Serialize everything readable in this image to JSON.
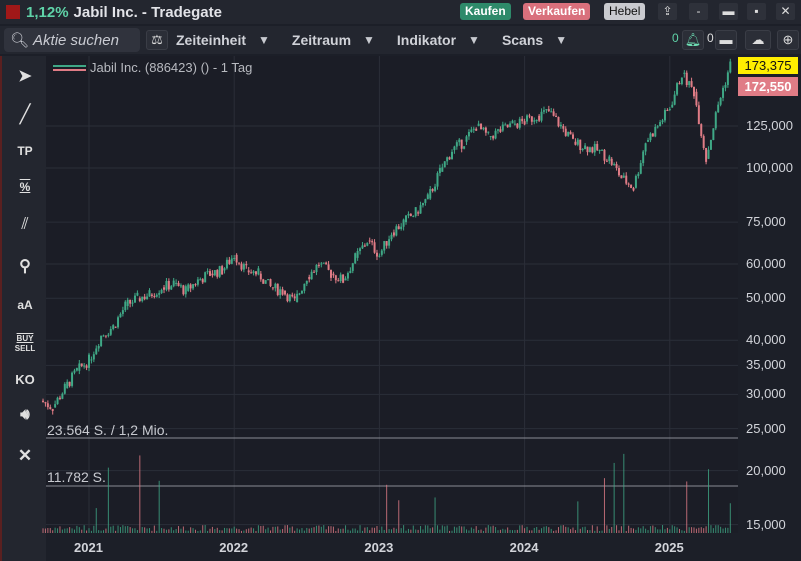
{
  "titlebar": {
    "change": "1,12%",
    "title": "Jabil Inc. - Tradegate",
    "buy": "Kaufen",
    "sell": "Verkaufen",
    "leverage": "Hebel",
    "minimize": "-",
    "restore": "▬",
    "close": "✕"
  },
  "toolbar": {
    "search_placeholder": "Aktie suchen",
    "menus": [
      "Zeiteinheit",
      "Zeitraum",
      "Indikator",
      "Scans"
    ],
    "alert_count": "0",
    "folder_count": "0"
  },
  "sidebar": {
    "tools": [
      "cursor-crosshair",
      "line",
      "TP",
      "%",
      "parallel-lines",
      "zoom",
      "aA",
      "BUY SELL",
      "KO",
      "sound",
      "close"
    ],
    "tp": "TP",
    "pct": "%",
    "text": "aA",
    "buy": "BUY",
    "sell": "SELL",
    "ko": "KO"
  },
  "legend": {
    "label": "Jabil Inc. (886423) () - 1 Tag"
  },
  "colors": {
    "up": "#3fa886",
    "down": "#e07c86",
    "last": "#ffee00",
    "bid": "#e07c86",
    "buy": "#2e8a6a",
    "sell": "#d9707c"
  },
  "chart_data": {
    "type": "candlestick",
    "scale": "log",
    "ylim": [
      14000,
      180000
    ],
    "yticks": [
      "125,000",
      "100,000",
      "75,000",
      "60,000",
      "50,000",
      "40,000",
      "35,000",
      "30,000",
      "25,000",
      "20,000",
      "15,000"
    ],
    "ytick_values": [
      125,
      100,
      75,
      60,
      50,
      40,
      35,
      30,
      25,
      20,
      15
    ],
    "xticks": [
      "2021",
      "2022",
      "2023",
      "2024",
      "2025"
    ],
    "dates": [
      "2020-09",
      "2020-10",
      "2020-11",
      "2020-12",
      "2021-01",
      "2021-02",
      "2021-03",
      "2021-04",
      "2021-05",
      "2021-06",
      "2021-07",
      "2021-08",
      "2021-09",
      "2021-10",
      "2021-11",
      "2021-12",
      "2022-01",
      "2022-02",
      "2022-03",
      "2022-04",
      "2022-05",
      "2022-06",
      "2022-07",
      "2022-08",
      "2022-09",
      "2022-10",
      "2022-11",
      "2022-12",
      "2023-01",
      "2023-02",
      "2023-03",
      "2023-04",
      "2023-05",
      "2023-06",
      "2023-07",
      "2023-08",
      "2023-09",
      "2023-10",
      "2023-11",
      "2023-12",
      "2024-01",
      "2024-02",
      "2024-03",
      "2024-04",
      "2024-05",
      "2024-06",
      "2024-07",
      "2024-08",
      "2024-09",
      "2024-10",
      "2024-11",
      "2024-12",
      "2025-01",
      "2025-02",
      "2025-03",
      "2025-04",
      "2025-05",
      "2025-06"
    ],
    "close": [
      29,
      28,
      31,
      34,
      36,
      41,
      43,
      48,
      50,
      51,
      53,
      54,
      52,
      55,
      57,
      58,
      63,
      58,
      57,
      53,
      52,
      49,
      56,
      60,
      57,
      55,
      62,
      68,
      63,
      71,
      75,
      79,
      85,
      98,
      110,
      115,
      125,
      118,
      122,
      126,
      128,
      132,
      135,
      125,
      115,
      112,
      110,
      105,
      95,
      90,
      115,
      125,
      138,
      165,
      150,
      105,
      140,
      173.375
    ],
    "last_price": "173,375",
    "bid_price": "172,550",
    "volume_levels": [
      {
        "label": "23.564 S. / 1,2 Mio."
      },
      {
        "label": "11.782 S."
      }
    ]
  }
}
